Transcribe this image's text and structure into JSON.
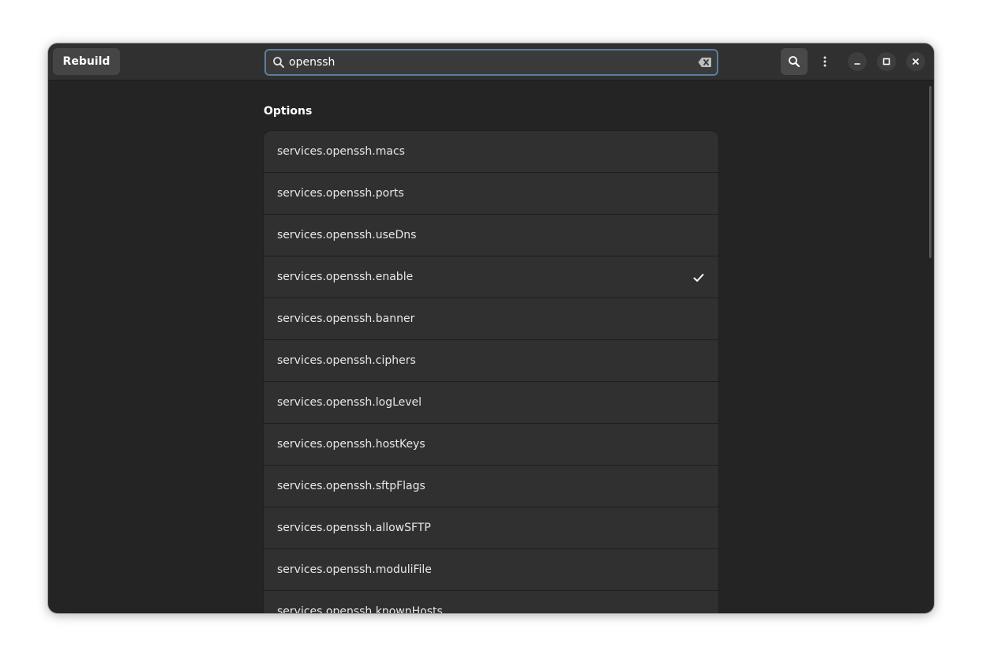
{
  "header": {
    "rebuild_label": "Rebuild",
    "search_value": "openssh"
  },
  "icons": {
    "search": "search-icon",
    "clear": "backspace-clear-icon",
    "menu": "vertical-ellipsis-icon",
    "minimize": "minimize-icon",
    "maximize": "maximize-icon",
    "close": "close-icon",
    "check": "checkmark-icon"
  },
  "main": {
    "section_title": "Options",
    "options": [
      {
        "label": "services.openssh.macs",
        "checked": false
      },
      {
        "label": "services.openssh.ports",
        "checked": false
      },
      {
        "label": "services.openssh.useDns",
        "checked": false
      },
      {
        "label": "services.openssh.enable",
        "checked": true
      },
      {
        "label": "services.openssh.banner",
        "checked": false
      },
      {
        "label": "services.openssh.ciphers",
        "checked": false
      },
      {
        "label": "services.openssh.logLevel",
        "checked": false
      },
      {
        "label": "services.openssh.hostKeys",
        "checked": false
      },
      {
        "label": "services.openssh.sftpFlags",
        "checked": false
      },
      {
        "label": "services.openssh.allowSFTP",
        "checked": false
      },
      {
        "label": "services.openssh.moduliFile",
        "checked": false
      },
      {
        "label": "services.openssh.knownHosts",
        "checked": false
      }
    ]
  },
  "colors": {
    "window_bg": "#242424",
    "headerbar_bg": "#303030",
    "row_bg": "#303030",
    "focus_ring": "#5a7d9e",
    "text": "#ffffff"
  }
}
